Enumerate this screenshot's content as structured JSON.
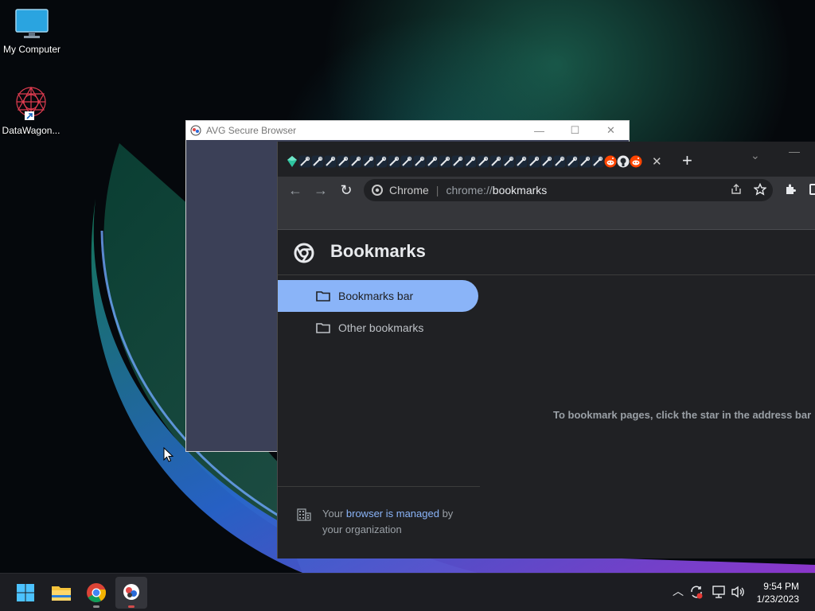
{
  "desktop": {
    "icons": [
      {
        "label": "My Computer",
        "icon": "monitor-icon"
      },
      {
        "label": "DataWagon...",
        "icon": "datawagon-logo-icon"
      }
    ]
  },
  "avg_window": {
    "title": "AVG Secure Browser"
  },
  "chrome": {
    "tab_favicons": [
      "gem-icon",
      "steam-icon",
      "steam-icon",
      "steam-icon",
      "steam-icon",
      "steam-icon",
      "steam-icon",
      "steam-icon",
      "steam-icon",
      "steam-icon",
      "steam-icon",
      "steam-icon",
      "steam-icon",
      "steam-icon",
      "steam-icon",
      "steam-icon",
      "steam-icon",
      "steam-icon",
      "steam-icon",
      "steam-icon",
      "steam-icon",
      "steam-icon",
      "steam-icon",
      "steam-icon",
      "steam-icon",
      "reddit-icon",
      "github-icon",
      "reddit-icon"
    ],
    "tab_close": "✕",
    "new_tab": "+",
    "omnibox": {
      "chip_label": "Chrome",
      "url_scheme": "chrome://",
      "url_path": "bookmarks"
    },
    "page": {
      "title": "Bookmarks",
      "sidebar": [
        {
          "label": "Bookmarks bar",
          "selected": true
        },
        {
          "label": "Other bookmarks",
          "selected": false
        }
      ],
      "managed": {
        "prefix": "Your ",
        "link": "browser is managed",
        "suffix": " by your organization"
      },
      "empty_message": "To bookmark pages, click the star in the address bar"
    }
  },
  "taskbar": {
    "apps": [
      "windows-start-icon",
      "file-explorer-icon",
      "chrome-icon",
      "avg-browser-icon"
    ],
    "clock": {
      "time": "9:54 PM",
      "date": "1/23/2023"
    }
  },
  "colors": {
    "accent_blue": "#8ab4f8",
    "chrome_bg": "#202124",
    "toolbar_bg": "#35363a",
    "avg_body": "#3b4057"
  }
}
